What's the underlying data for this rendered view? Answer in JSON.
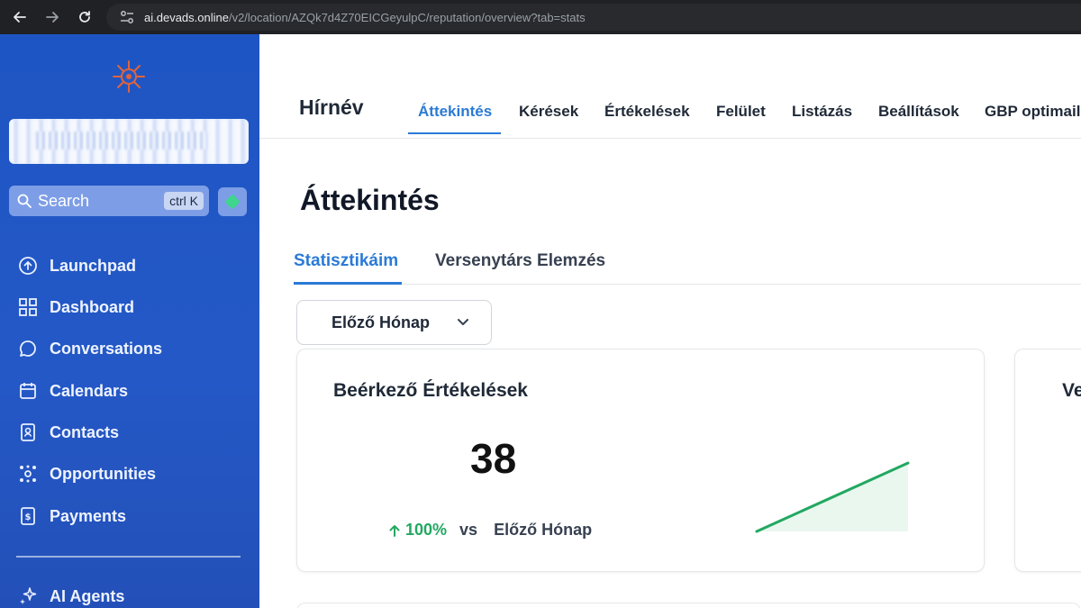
{
  "browser": {
    "url_host": "ai.devads.online",
    "url_path": "/v2/location/AZQk7d4Z70EICGeyulpC/reputation/overview?tab=stats"
  },
  "sidebar": {
    "search": {
      "label": "Search",
      "shortcut": "ctrl K"
    },
    "items": [
      {
        "label": "Launchpad",
        "icon": "launchpad-icon"
      },
      {
        "label": "Dashboard",
        "icon": "dashboard-icon"
      },
      {
        "label": "Conversations",
        "icon": "chat-icon"
      },
      {
        "label": "Calendars",
        "icon": "calendar-icon"
      },
      {
        "label": "Contacts",
        "icon": "contacts-icon"
      },
      {
        "label": "Opportunities",
        "icon": "opportunities-icon"
      },
      {
        "label": "Payments",
        "icon": "payments-icon"
      },
      {
        "label": "AI Agents",
        "icon": "sparkle-icon"
      }
    ],
    "colors": {
      "bg": "#2458c6",
      "accent": "#3dd68c"
    }
  },
  "topnav": {
    "title": "Hírnév",
    "tabs": [
      {
        "label": "Áttekintés",
        "active": true
      },
      {
        "label": "Kérések"
      },
      {
        "label": "Értékelések"
      },
      {
        "label": "Felület"
      },
      {
        "label": "Listázás"
      },
      {
        "label": "Beállítások"
      },
      {
        "label": "GBP optimaili"
      }
    ]
  },
  "page": {
    "title": "Áttekintés",
    "subtabs": [
      {
        "label": "Statisztikáim",
        "active": true
      },
      {
        "label": "Versenytárs Elemzés"
      }
    ],
    "period": "Előző Hónap"
  },
  "cards": {
    "incoming": {
      "title": "Beérkező Értékelések",
      "value": "38",
      "change": "100%",
      "vs": "vs",
      "compare": "Előző Hónap",
      "trend_color": "#22a861"
    },
    "second": {
      "title": "Ve"
    }
  }
}
